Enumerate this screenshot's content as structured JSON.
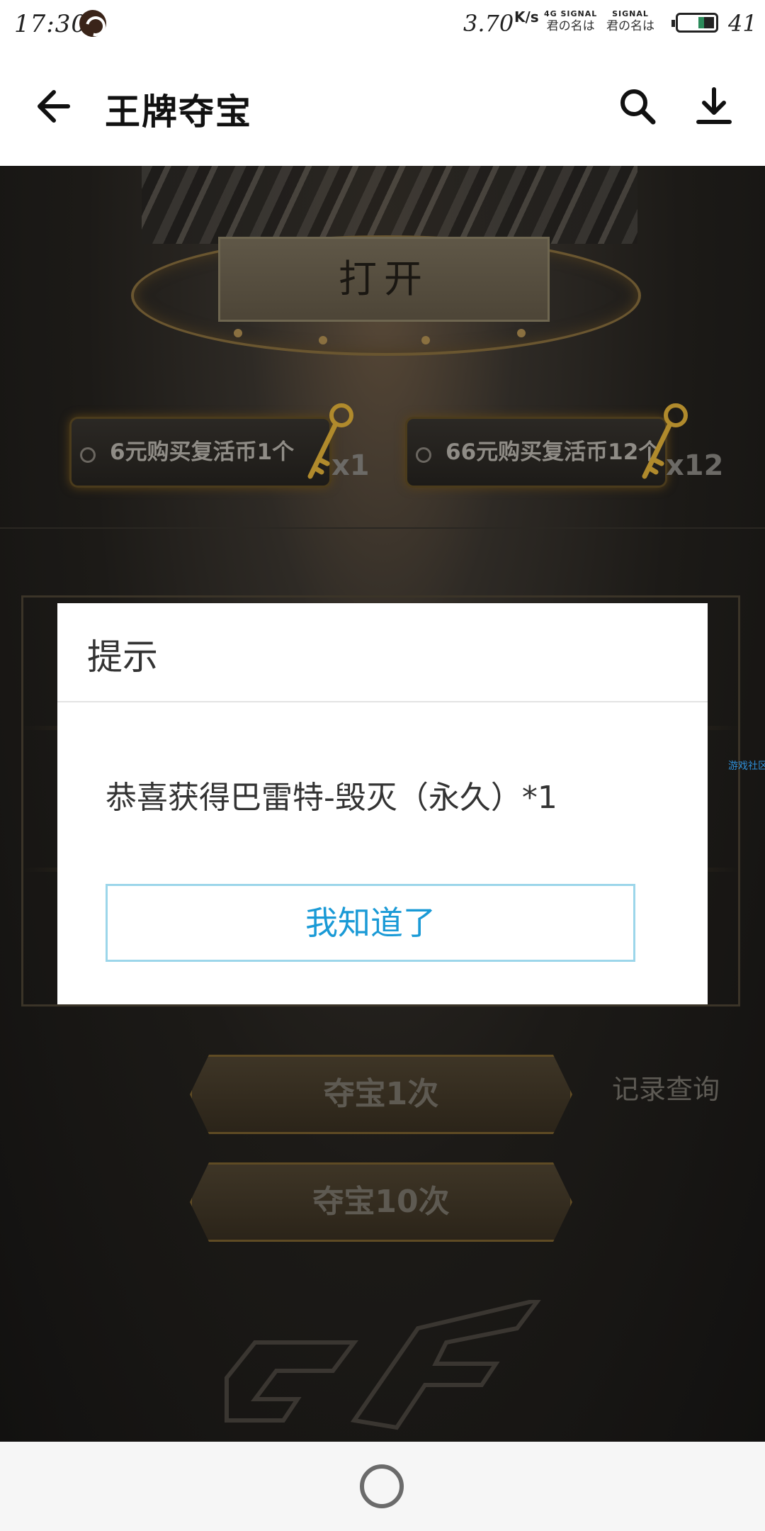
{
  "status_bar": {
    "time": "17:30",
    "speed": "3.70",
    "speed_unit": "K/s",
    "signal_1_top": "4G SIGNAL",
    "signal_1_carrier": "君の名は",
    "signal_2_top": "SIGNAL",
    "signal_2_carrier": "君の名は",
    "battery": "41"
  },
  "app_bar": {
    "title": "王牌夺宝",
    "icons": [
      "back-arrow-icon",
      "search-icon",
      "download-icon"
    ]
  },
  "game": {
    "open_button": "打开",
    "buy_options": [
      {
        "label": "6元购买复活币1个",
        "count": "x1"
      },
      {
        "label": "66元购买复活币12个",
        "count": "x12"
      }
    ],
    "side_label": "游戏社区",
    "draw_once": "夺宝1次",
    "draw_ten": "夺宝10次",
    "record_link": "记录查询"
  },
  "dialog": {
    "title": "提示",
    "message": "恭喜获得巴雷特-毁灭（永久）*1",
    "confirm": "我知道了"
  },
  "colors": {
    "dialog_button_text": "#1a9ad6",
    "dialog_button_border": "#9cd6ea",
    "game_background": "#1c1a17",
    "gold_accent": "#6a5630"
  }
}
